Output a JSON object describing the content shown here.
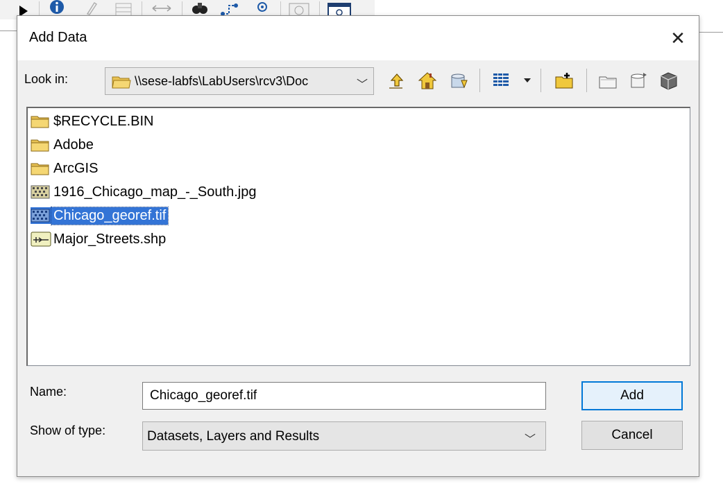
{
  "background_toolbar": {
    "icons": [
      "select-arrow-icon",
      "identify-icon",
      "html-popup-icon",
      "table-icon",
      "measure-icon",
      "find-icon",
      "route-icon",
      "goto-xy-icon",
      "time-slider-icon",
      "viewer-icon"
    ]
  },
  "dialog": {
    "title": "Add Data",
    "close_glyph": "✕"
  },
  "look_in": {
    "label": "Look in:",
    "path": "\\\\sese-labfs\\LabUsers\\rcv3\\Doc",
    "dropdown_glyph": "﹀"
  },
  "toolbar": {
    "buttons": [
      {
        "icon": "up-one-level-icon"
      },
      {
        "icon": "home-icon"
      },
      {
        "icon": "go-to-default-geodatabase-icon"
      },
      {
        "icon": "list-view-icon"
      },
      {
        "icon": "view-options-dropdown-icon"
      },
      {
        "icon": "connect-to-folder-icon"
      },
      {
        "icon": "new-folder-icon"
      },
      {
        "icon": "new-geodatabase-icon"
      },
      {
        "icon": "new-feature-class-icon"
      }
    ]
  },
  "files": [
    {
      "name": "$RECYCLE.BIN",
      "icon": "folder-icon",
      "selected": false
    },
    {
      "name": "Adobe",
      "icon": "folder-icon",
      "selected": false
    },
    {
      "name": "ArcGIS",
      "icon": "folder-icon",
      "selected": false
    },
    {
      "name": "1916_Chicago_map_-_South.jpg",
      "icon": "raster-icon",
      "selected": false
    },
    {
      "name": "Chicago_georef.tif",
      "icon": "raster-icon",
      "selected": true
    },
    {
      "name": "Major_Streets.shp",
      "icon": "line-shapefile-icon",
      "selected": false
    }
  ],
  "name_field": {
    "label": "Name:",
    "value": "Chicago_georef.tif"
  },
  "type_field": {
    "label": "Show of type:",
    "value": "Datasets, Layers and Results",
    "dropdown_glyph": "﹀"
  },
  "buttons": {
    "add": "Add",
    "cancel": "Cancel"
  },
  "colors": {
    "selection": "#3374d6",
    "dialog_bg": "#f0f0f0",
    "default_button_border": "#0078d7"
  }
}
